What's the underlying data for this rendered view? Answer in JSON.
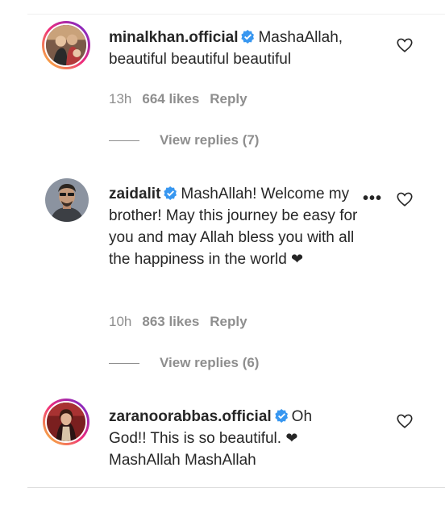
{
  "comments": [
    {
      "username": "minalkhan.official",
      "text": "MashaAllah, beautiful beautiful beautiful",
      "time": "13h",
      "likes": "664 likes",
      "reply": "Reply",
      "view_replies": "View replies (7)"
    },
    {
      "username": "zaidalit",
      "text": "MashAllah! Welcome my brother! May this journey be easy for you and may Allah bless you with all the happiness in the world",
      "emoji": "❤",
      "more": "•••",
      "time": "10h",
      "likes": "863 likes",
      "reply": "Reply",
      "view_replies": "View replies (6)"
    },
    {
      "username": "zaranoorabbas.official",
      "text_line1": "Oh",
      "text_line2": "God!! This is so beautiful.",
      "emoji": "❤",
      "text_line3": "MashAllah MashAllah"
    }
  ],
  "colors": {
    "verified": "#3897f0",
    "meta": "#8e8e8e",
    "text": "#262626"
  },
  "icons": {
    "like": "heart-outline-icon",
    "verified": "verified-badge-icon",
    "more": "more-options-icon"
  }
}
